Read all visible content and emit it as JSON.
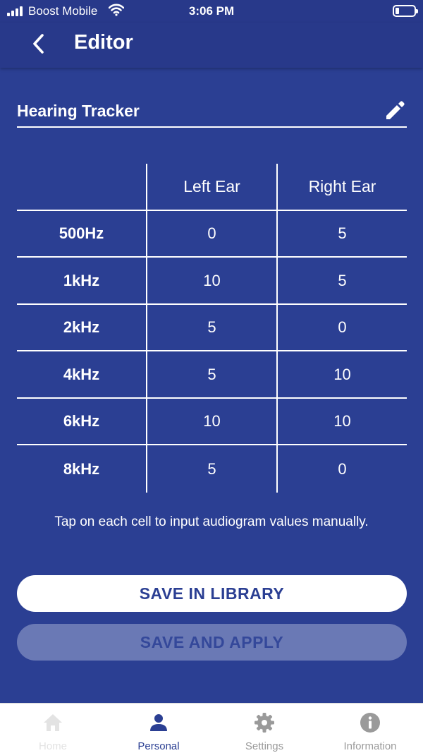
{
  "status_bar": {
    "carrier": "Boost Mobile",
    "time": "3:06 PM"
  },
  "nav": {
    "title": "Editor",
    "back_icon": "chevron-left-icon"
  },
  "profile": {
    "name": "Hearing Tracker",
    "edit_icon": "pencil-icon"
  },
  "audiogram": {
    "columns": [
      "Left Ear",
      "Right Ear"
    ],
    "rows": [
      {
        "freq": "500Hz",
        "left": "0",
        "right": "5"
      },
      {
        "freq": "1kHz",
        "left": "10",
        "right": "5"
      },
      {
        "freq": "2kHz",
        "left": "5",
        "right": "0"
      },
      {
        "freq": "4kHz",
        "left": "5",
        "right": "10"
      },
      {
        "freq": "6kHz",
        "left": "10",
        "right": "10"
      },
      {
        "freq": "8kHz",
        "left": "5",
        "right": "0"
      }
    ]
  },
  "hint": "Tap on each cell to input audiogram values manually.",
  "buttons": {
    "save_library": "SAVE IN LIBRARY",
    "save_apply": "SAVE AND APPLY",
    "save_apply_enabled": false
  },
  "tabs": [
    {
      "label": "Home",
      "icon": "home-icon",
      "active": false,
      "color": "#e3e3e3"
    },
    {
      "label": "Personal",
      "icon": "person-icon",
      "active": true,
      "color": "#2b3f93"
    },
    {
      "label": "Settings",
      "icon": "gear-icon",
      "active": false,
      "color": "#9a9a9a"
    },
    {
      "label": "Information",
      "icon": "info-icon",
      "active": false,
      "color": "#9a9a9a"
    }
  ],
  "colors": {
    "background": "#2b3f93",
    "header": "#28398a",
    "primary_button": "#ffffff",
    "disabled_button": "#6a79b5"
  }
}
